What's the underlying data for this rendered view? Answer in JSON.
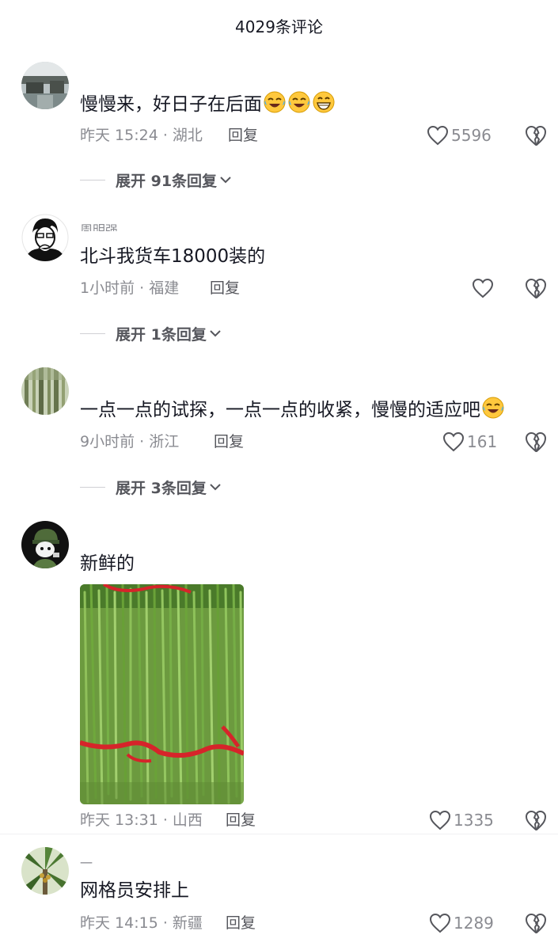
{
  "header": {
    "title": "4029条评论"
  },
  "comments": [
    {
      "text": "慢慢来，好日子在后面",
      "emoji": [
        "laughing-tears-emoji",
        "laughing-tears-emoji",
        "grinning-emoji"
      ],
      "time_location": "昨天 15:24 · 湖北",
      "reply_label": "回复",
      "likes": "5596",
      "expand_label": "展开 91条回复"
    },
    {
      "username": "周明强",
      "text": "北斗我货车18000装的",
      "time_location": "1小时前 · 福建",
      "reply_label": "回复",
      "likes": "",
      "expand_label": "展开 1条回复"
    },
    {
      "text": "一点一点的试探，一点一点的收紧，慢慢的适应吧",
      "emoji": [
        "laughing-tears-emoji"
      ],
      "time_location": "9小时前 · 浙江",
      "reply_label": "回复",
      "likes": "161",
      "expand_label": "展开 3条回复"
    },
    {
      "text": "新鲜的",
      "image": "chives-bundle-photo",
      "time_location": "昨天 13:31 · 山西",
      "reply_label": "回复",
      "likes": "1335"
    },
    {
      "username": "一",
      "text": "网格员安排上",
      "time_location": "昨天 14:15 · 新疆",
      "reply_label": "回复",
      "likes": "1289"
    }
  ],
  "icons": {
    "like": "heart-outline-icon",
    "dislike": "broken-heart-icon",
    "expand": "chevron-down-icon"
  },
  "colors": {
    "text": "#161823",
    "muted": "#8a8b91",
    "reply": "#55565c"
  }
}
